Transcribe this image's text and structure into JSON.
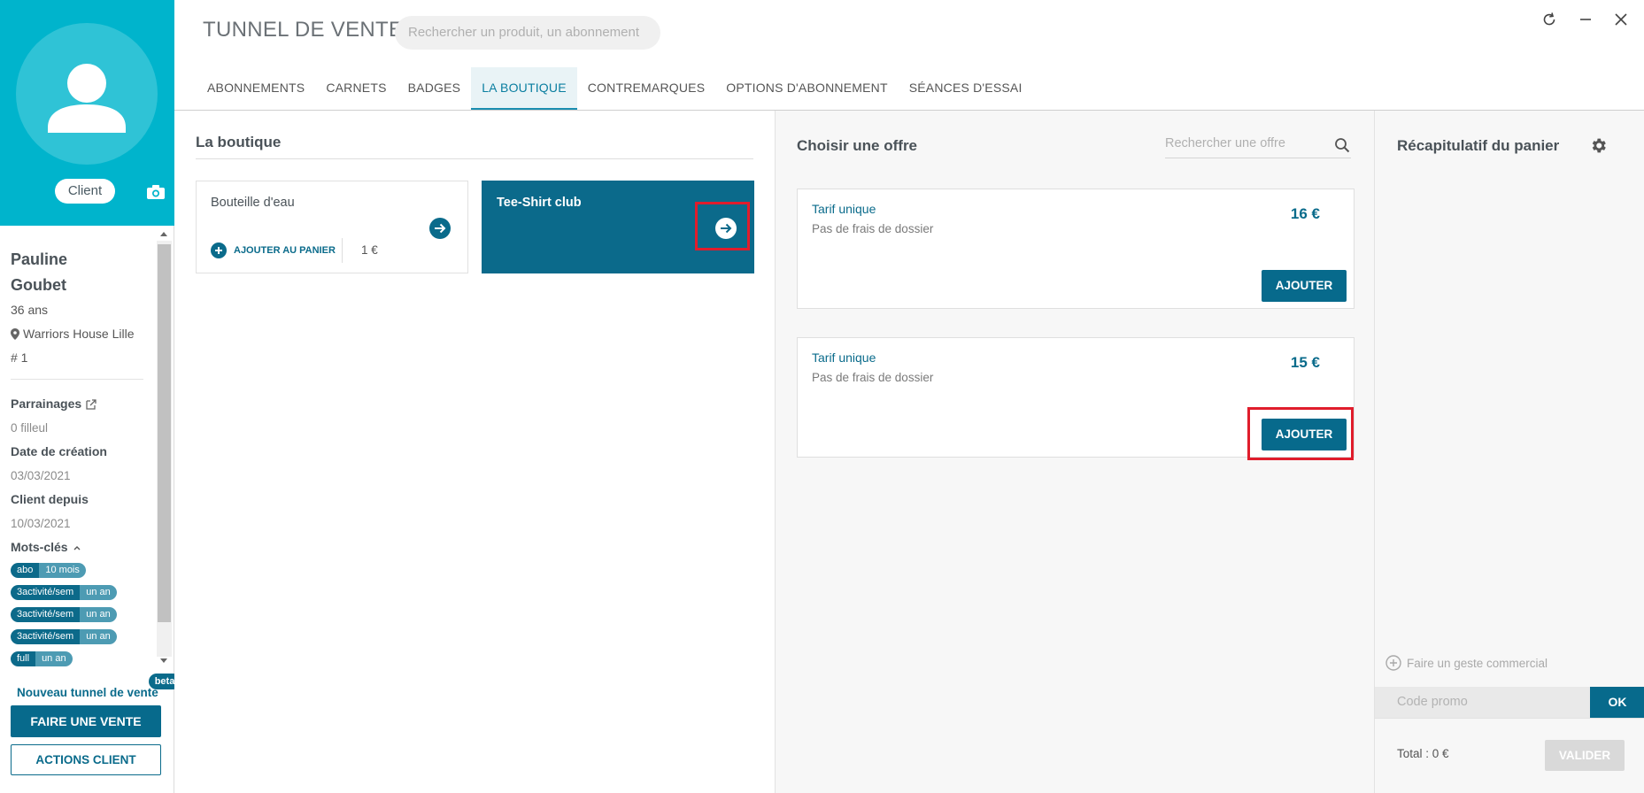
{
  "sidebar": {
    "client_badge": "Client",
    "first_name": "Pauline",
    "last_name": "Goubet",
    "age": "36 ans",
    "location": "Warriors House Lille",
    "number": "# 1",
    "parrainages_label": "Parrainages",
    "filleul": "0 filleul",
    "creation_label": "Date de création",
    "creation_date": "03/03/2021",
    "client_since_label": "Client depuis",
    "client_since_date": "10/03/2021",
    "keywords_label": "Mots-clés",
    "tags": [
      {
        "key": "abo",
        "value": "10 mois"
      },
      {
        "key": "3activité/sem",
        "value": "un an"
      },
      {
        "key": "3activité/sem",
        "value": "un an"
      },
      {
        "key": "3activité/sem",
        "value": "un an"
      },
      {
        "key": "full",
        "value": "un an"
      }
    ],
    "new_tunnel": "Nouveau tunnel de vente",
    "beta": "beta",
    "sale_button": "FAIRE UNE VENTE",
    "actions_button": "ACTIONS CLIENT"
  },
  "header": {
    "title": "TUNNEL DE VENTE",
    "search_placeholder": "Rechercher un produit, un abonnement",
    "tabs": [
      "ABONNEMENTS",
      "CARNETS",
      "BADGES",
      "LA BOUTIQUE",
      "CONTREMARQUES",
      "OPTIONS D'ABONNEMENT",
      "SÉANCES D'ESSAI"
    ],
    "active_tab": "LA BOUTIQUE"
  },
  "boutique": {
    "title": "La boutique",
    "products": [
      {
        "name": "Bouteille d'eau",
        "add_label": "AJOUTER AU PANIER",
        "price": "1 €"
      },
      {
        "name": "Tee-Shirt club"
      }
    ]
  },
  "offers": {
    "title": "Choisir une offre",
    "search_placeholder": "Rechercher une offre",
    "items": [
      {
        "name": "Tarif unique",
        "subtitle": "Pas de frais de dossier",
        "price": "16 €",
        "button": "AJOUTER"
      },
      {
        "name": "Tarif unique",
        "subtitle": "Pas de frais de dossier",
        "price": "15 €",
        "button": "AJOUTER"
      }
    ]
  },
  "recap": {
    "title": "Récapitulatif du panier",
    "geste": "Faire un geste commercial",
    "promo_placeholder": "Code promo",
    "ok": "OK",
    "total": "Total : 0 €",
    "valider": "VALIDER"
  },
  "colors": {
    "teal_header": "#00b4cc",
    "primary": "#076a8c",
    "highlight_red": "#e01d2c",
    "tag_red": "#e04545"
  }
}
